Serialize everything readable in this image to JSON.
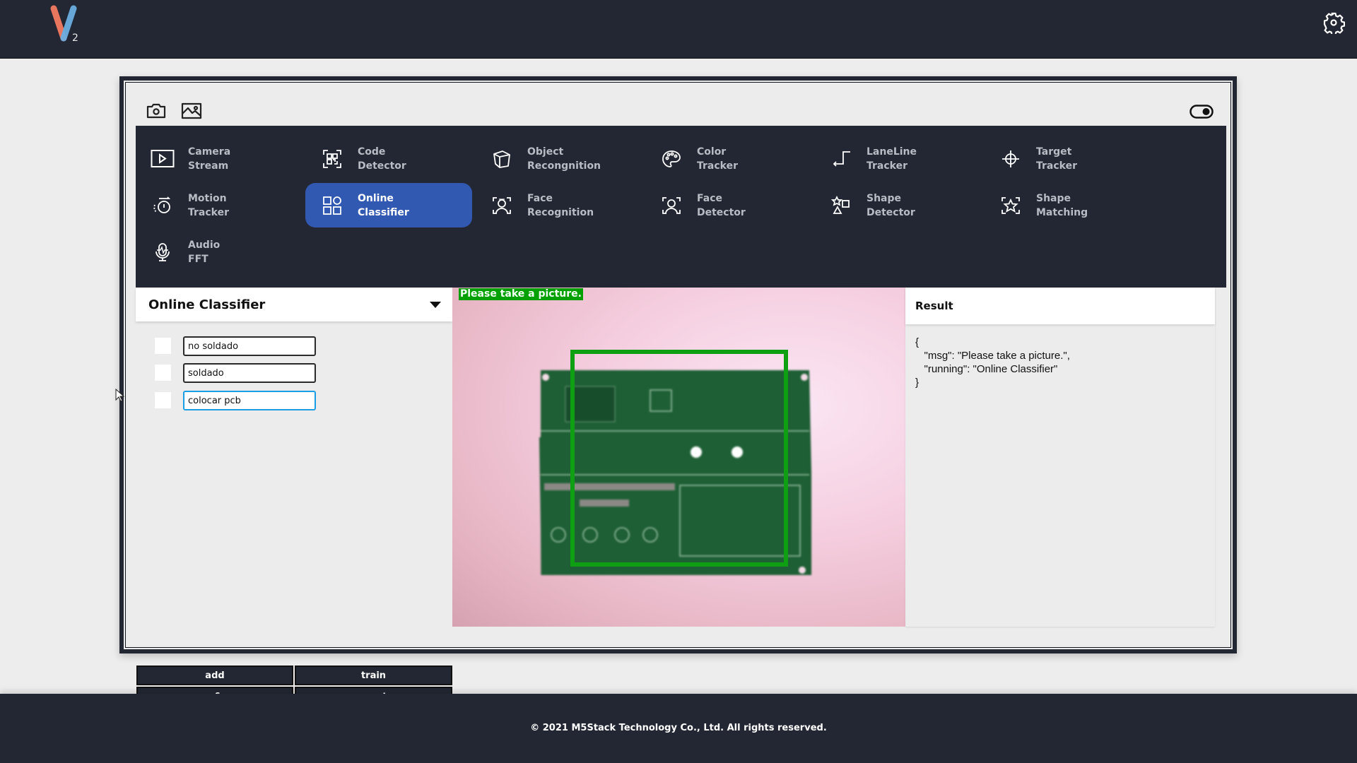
{
  "header": {
    "logo_letter": "V",
    "logo_subscript": "2",
    "settings_icon": "gear-icon"
  },
  "toolbar": {
    "icons": [
      "camera-icon",
      "image-icon"
    ],
    "toggle_icon": "toggle-icon"
  },
  "menu": {
    "active": "Online Classifier",
    "items": [
      {
        "line1": "Camera",
        "line2": "Stream",
        "icon": "play-icon"
      },
      {
        "line1": "Code",
        "line2": "Detector",
        "icon": "qr-code-icon"
      },
      {
        "line1": "Object",
        "line2": "Recongnition",
        "icon": "cube-icon"
      },
      {
        "line1": "Color",
        "line2": "Tracker",
        "icon": "palette-icon"
      },
      {
        "line1": "LaneLine",
        "line2": "Tracker",
        "icon": "lane-line-icon"
      },
      {
        "line1": "Target",
        "line2": "Tracker",
        "icon": "crosshair-icon"
      },
      {
        "line1": "Motion",
        "line2": "Tracker",
        "icon": "motion-icon"
      },
      {
        "line1": "Online",
        "line2": "Classifier",
        "icon": "shapes-grid-icon"
      },
      {
        "line1": "Face",
        "line2": "Recognition",
        "icon": "face-recognition-icon"
      },
      {
        "line1": "Face",
        "line2": "Detector",
        "icon": "face-detector-icon"
      },
      {
        "line1": "Shape",
        "line2": "Detector",
        "icon": "shape-detector-icon"
      },
      {
        "line1": "Shape",
        "line2": "Matching",
        "icon": "shape-matching-icon"
      },
      {
        "line1": "Audio",
        "line2": "FFT",
        "icon": "microphone-icon"
      }
    ]
  },
  "classifier": {
    "title": "Online Classifier",
    "classes": [
      {
        "value": "no soldado",
        "checked": false
      },
      {
        "value": "soldado",
        "checked": false
      },
      {
        "value": "colocar pcb",
        "checked": false,
        "focused": true
      }
    ],
    "buttons": {
      "add": "add",
      "train": "train",
      "save_run": "save&run",
      "reset": "reset"
    }
  },
  "video": {
    "message": "Please take a picture.",
    "box_color": "#0ea012"
  },
  "result": {
    "title": "Result",
    "json_text": "{\n   \"msg\": \"Please take a picture.\",\n   \"running\": \"Online Classifier\"\n}"
  },
  "footer": {
    "copyright": "© 2021 M5Stack Technology Co., Ltd. All rights reserved."
  },
  "colors": {
    "dark": "#222733",
    "accent": "#3259b2",
    "menu_text": "#b8bcc4"
  }
}
